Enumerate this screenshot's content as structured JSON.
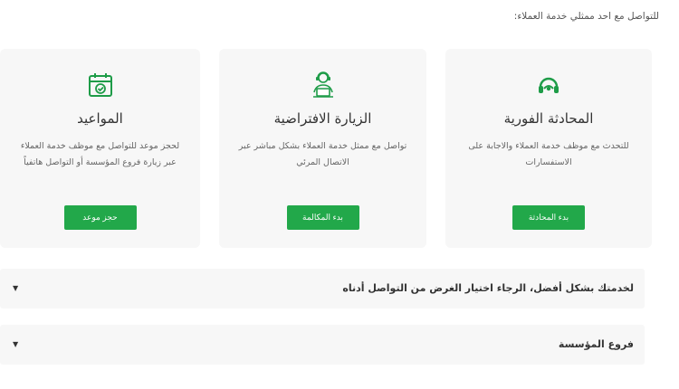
{
  "intro_text": "للتواصل مع احد ممثلي خدمة العملاء:",
  "colors": {
    "accent": "#22a84a",
    "card_bg": "#f7f7f7"
  },
  "cards": [
    {
      "icon": "headset-icon",
      "title": "المحادثة الفورية",
      "description": "للتحدث مع موظف خدمة العملاء والاجابة على الاستفسارات",
      "button": "بدء المحادثة"
    },
    {
      "icon": "agent-icon",
      "title": "الزيارة الافتراضية",
      "description": "تواصل مع ممثل خدمة العملاء بشكل مباشر عبر الاتصال المرئي",
      "button": "بدء المكالمة"
    },
    {
      "icon": "calendar-icon",
      "title": "المواعيد",
      "description": "لحجز موعد للتواصل مع موظف خدمة العملاء عبر زيارة فروع المؤسسة أو التواصل هاتفياً",
      "button": "حجز موعد"
    }
  ],
  "accordions": [
    {
      "label": "لخدمتك بشكل أفضل، الرجاء اختيار الغرض من التواصل أدناه",
      "arrow": "▼"
    },
    {
      "label": "فروع المؤسسة",
      "arrow": "▼"
    }
  ]
}
